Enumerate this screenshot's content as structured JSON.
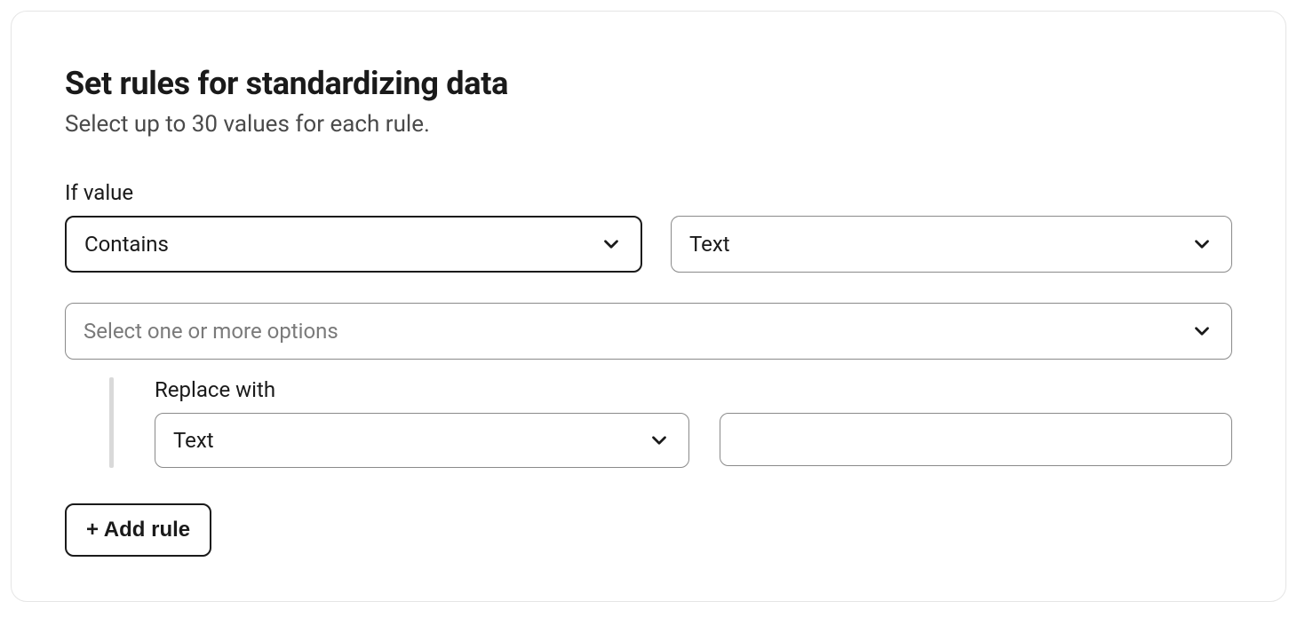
{
  "header": {
    "title": "Set rules for standardizing data",
    "subtitle": "Select up to 30 values for each rule."
  },
  "rule": {
    "if_value_label": "If value",
    "condition_selected": "Contains",
    "type_selected": "Text",
    "options_placeholder": "Select one or more options",
    "replace_with_label": "Replace with",
    "replace_type_selected": "Text",
    "replace_value": ""
  },
  "actions": {
    "add_rule_label": "+ Add rule"
  }
}
